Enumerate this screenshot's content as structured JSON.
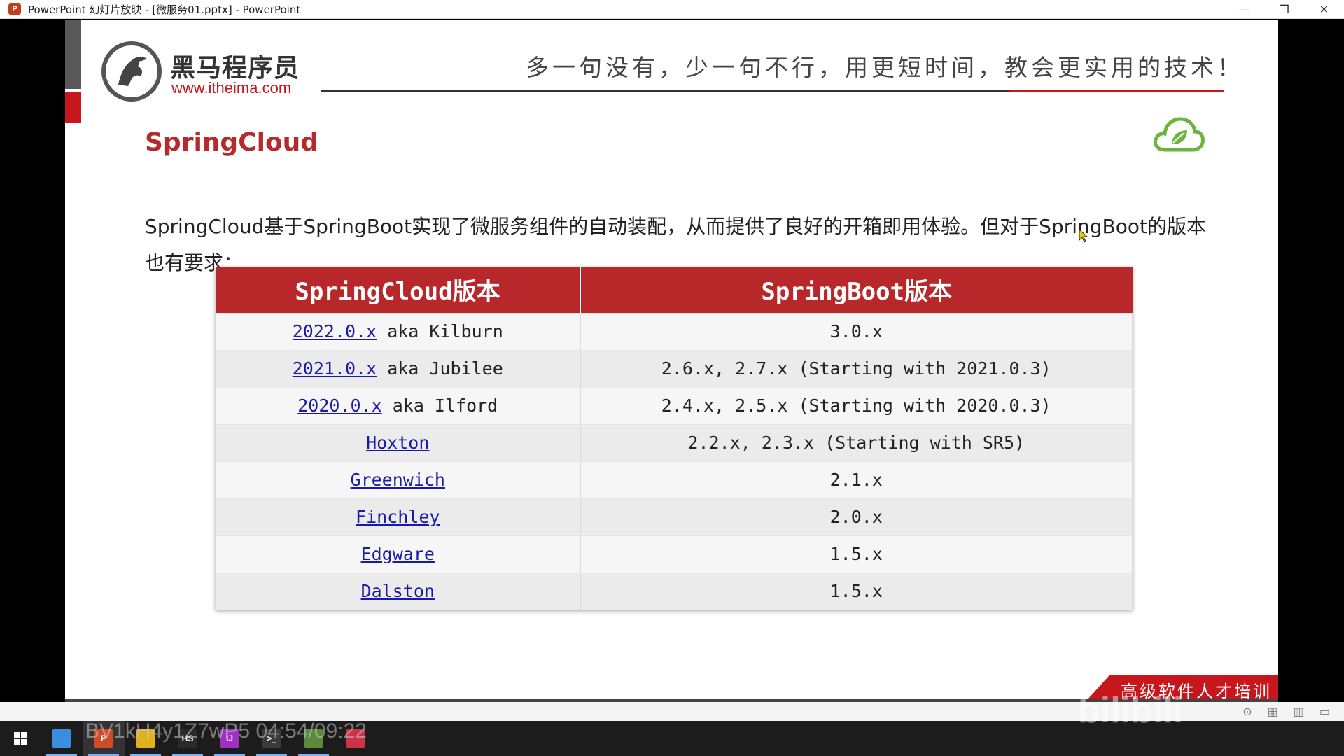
{
  "window": {
    "title": "PowerPoint 幻灯片放映 - [微服务01.pptx] - PowerPoint",
    "app_icon": "P",
    "controls": [
      "—",
      "❐",
      "✕"
    ]
  },
  "slide": {
    "logo_cn": "黑马程序员",
    "logo_url": "www.itheima.com",
    "slogan": "多一句没有，少一句不行，用更短时间，教会更实用的技术！",
    "title": "SpringCloud",
    "description": "SpringCloud基于SpringBoot实现了微服务组件的自动装配，从而提供了良好的开箱即用体验。但对于SpringBoot的版本也有要求：",
    "table": {
      "headers": [
        "SpringCloud版本",
        "SpringBoot版本"
      ],
      "rows": [
        {
          "link": "2022.0.x",
          "suffix": " aka Kilburn",
          "boot": "3.0.x"
        },
        {
          "link": "2021.0.x",
          "suffix": " aka Jubilee",
          "boot": "2.6.x, 2.7.x (Starting with 2021.0.3)"
        },
        {
          "link": "2020.0.x",
          "suffix": " aka Ilford",
          "boot": "2.4.x, 2.5.x (Starting with 2020.0.3)"
        },
        {
          "link": "Hoxton",
          "suffix": "",
          "boot": "2.2.x, 2.3.x (Starting with SR5)"
        },
        {
          "link": "Greenwich",
          "suffix": "",
          "boot": "2.1.x"
        },
        {
          "link": "Finchley",
          "suffix": "",
          "boot": "2.0.x"
        },
        {
          "link": "Edgware",
          "suffix": "",
          "boot": "1.5.x"
        },
        {
          "link": "Dalston",
          "suffix": "",
          "boot": "1.5.x"
        }
      ]
    },
    "footer_banner": "高级软件人才培训专家",
    "colors": {
      "brand_red": "#c8161d",
      "header_red": "#b8282b",
      "title_red": "#b52a2a",
      "link_blue": "#1a1aa6",
      "spring_green": "#6db33f"
    }
  },
  "overlay": {
    "video_id_text": "BV1kH4y1Z7wP5 04:54/09:22",
    "watermark": "bilibili"
  },
  "taskbar": {
    "apps": [
      {
        "name": "finder-app",
        "label": "",
        "color": "#3b8de0"
      },
      {
        "name": "powerpoint-app",
        "label": "P",
        "color": "#d04a2a"
      },
      {
        "name": "chrome-app",
        "label": "",
        "color": "#e0b020"
      },
      {
        "name": "hs-app",
        "label": "HS",
        "color": "#2a2a2a"
      },
      {
        "name": "intellij-app",
        "label": "IJ",
        "color": "#a030c0"
      },
      {
        "name": "terminal-app",
        "label": ">_",
        "color": "#3a3a3a"
      },
      {
        "name": "paint-app",
        "label": "",
        "color": "#5a8a3a"
      },
      {
        "name": "pen-app",
        "label": "",
        "color": "#cc3344"
      }
    ]
  }
}
